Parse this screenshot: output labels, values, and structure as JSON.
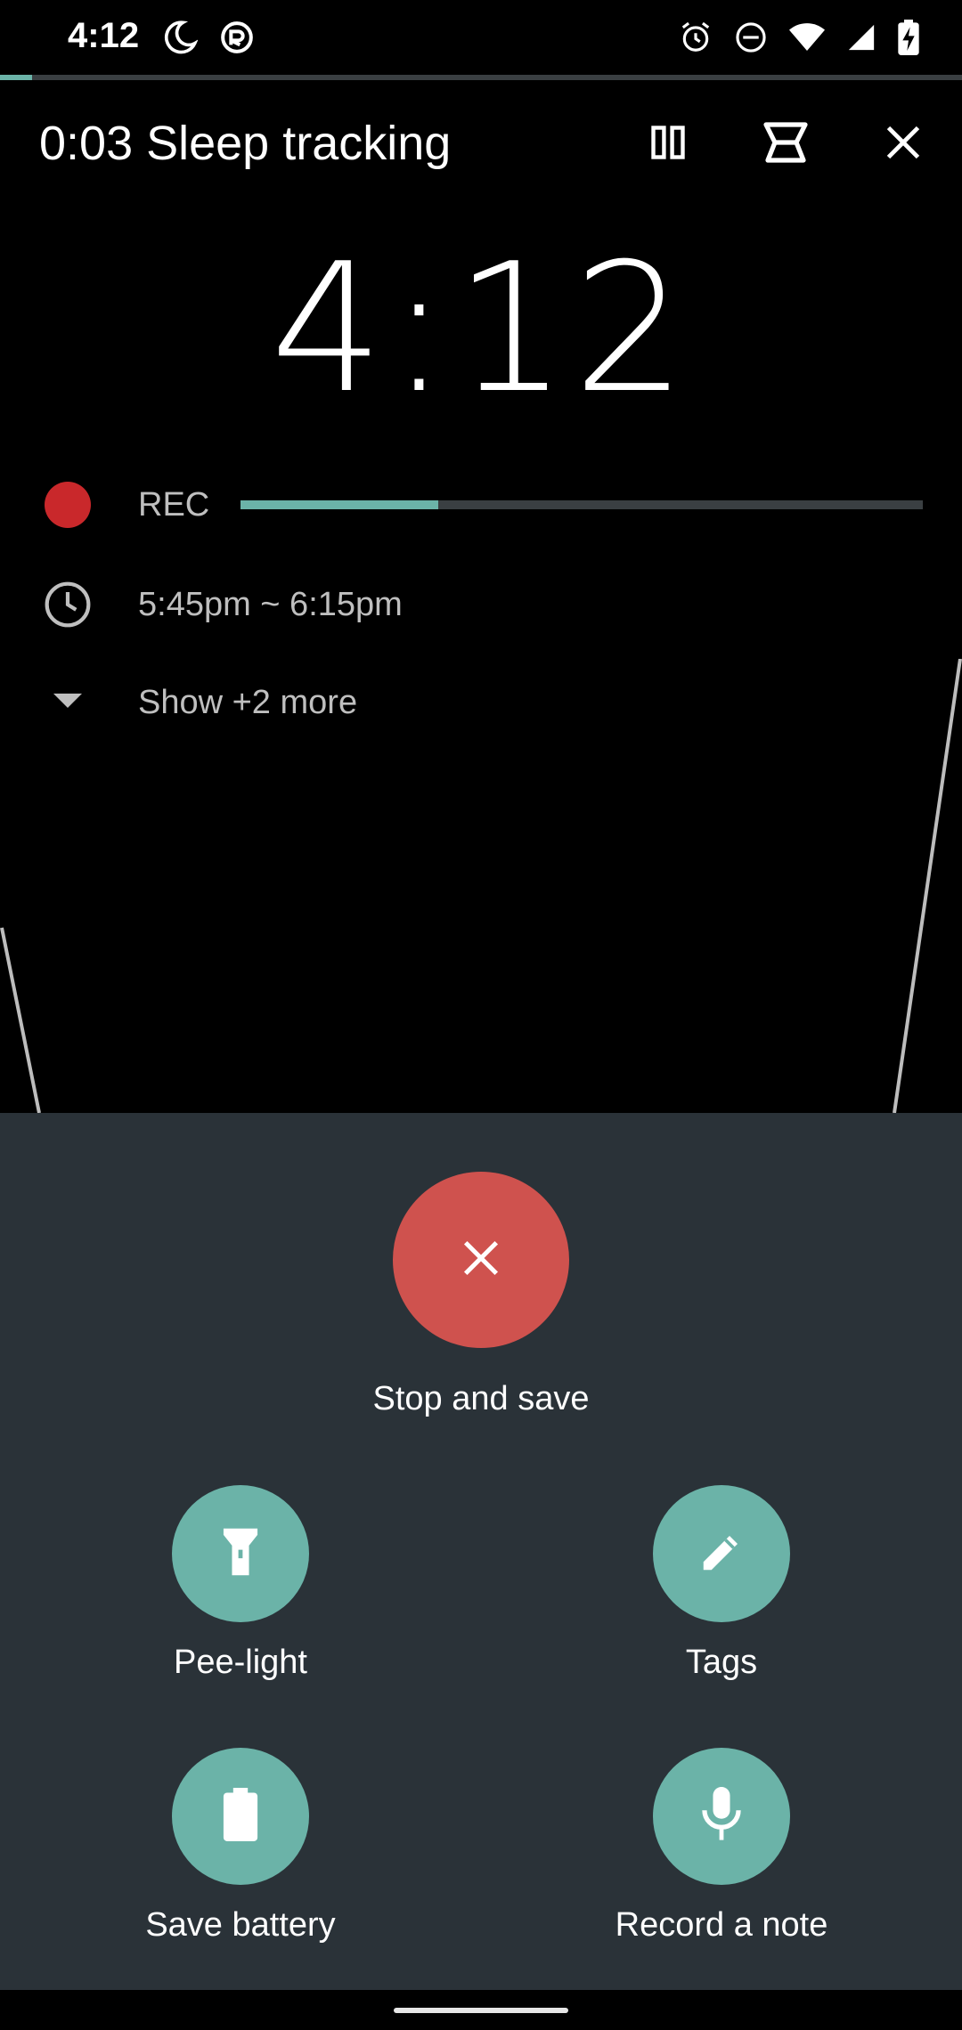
{
  "status_bar": {
    "time": "4:12"
  },
  "progress": {
    "top_fraction": 0.033,
    "rec_fraction": 0.29
  },
  "header": {
    "title": "0:03 Sleep tracking"
  },
  "clock": {
    "time": "4:12"
  },
  "info": {
    "rec_label": "REC",
    "alarm_window": "5:45pm ~ 6:15pm",
    "show_more": "Show +2 more"
  },
  "actions": {
    "stop_label": "Stop and save",
    "pee_light": "Pee-light",
    "tags": "Tags",
    "save_battery": "Save battery",
    "record_note": "Record a note"
  },
  "colors": {
    "accent": "#6bb3a8",
    "stop": "#cf524e",
    "rec": "#c9282b",
    "sheet": "#2a3238"
  }
}
